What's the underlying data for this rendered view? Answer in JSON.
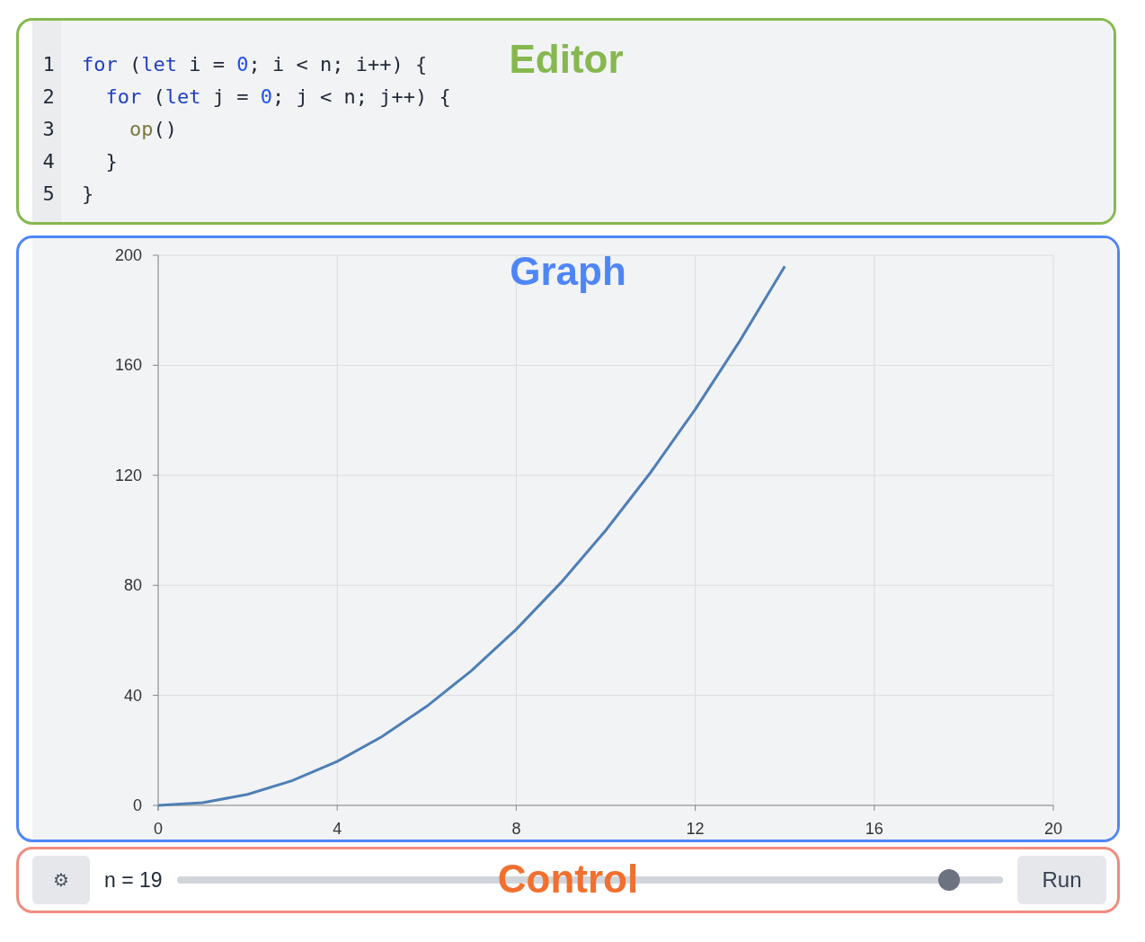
{
  "editor": {
    "label": "Editor",
    "lines": [
      {
        "number": "1",
        "tokens": [
          {
            "kind": "keyword",
            "text": "for"
          },
          {
            "kind": "plain",
            "text": " ("
          },
          {
            "kind": "keyword",
            "text": "let"
          },
          {
            "kind": "plain",
            "text": " i = "
          },
          {
            "kind": "number",
            "text": "0"
          },
          {
            "kind": "plain",
            "text": "; i < n; i++) {"
          }
        ]
      },
      {
        "number": "2",
        "tokens": [
          {
            "kind": "keyword",
            "text": "  for"
          },
          {
            "kind": "plain",
            "text": " ("
          },
          {
            "kind": "keyword",
            "text": "let"
          },
          {
            "kind": "plain",
            "text": " j = "
          },
          {
            "kind": "number",
            "text": "0"
          },
          {
            "kind": "plain",
            "text": "; j < n; j++) {"
          }
        ]
      },
      {
        "number": "3",
        "tokens": [
          {
            "kind": "function",
            "text": "    op"
          },
          {
            "kind": "plain",
            "text": "()"
          }
        ]
      },
      {
        "number": "4",
        "tokens": [
          {
            "kind": "plain",
            "text": "  }"
          }
        ]
      },
      {
        "number": "5",
        "tokens": [
          {
            "kind": "plain",
            "text": "}"
          }
        ]
      }
    ]
  },
  "graph": {
    "label": "Graph",
    "chart_data": {
      "type": "line",
      "x": [
        0,
        1,
        2,
        3,
        4,
        5,
        6,
        7,
        8,
        9,
        10,
        11,
        12,
        13,
        14
      ],
      "series": [
        {
          "color": "#4e7fb5",
          "values": [
            0,
            1,
            4,
            9,
            16,
            25,
            36,
            49,
            64,
            81,
            100,
            121,
            144,
            169,
            196
          ]
        }
      ],
      "grid": true,
      "xlim": [
        0,
        20
      ],
      "ylim": [
        0,
        200
      ],
      "xticks": [
        0,
        4,
        8,
        12,
        16,
        20
      ],
      "yticks": [
        0,
        40,
        80,
        120,
        160,
        200
      ]
    }
  },
  "control": {
    "label": "Control",
    "settings_icon": "⚙",
    "n_label": "n = 19",
    "slider": {
      "level": 0.935
    },
    "run_button": "Run"
  }
}
